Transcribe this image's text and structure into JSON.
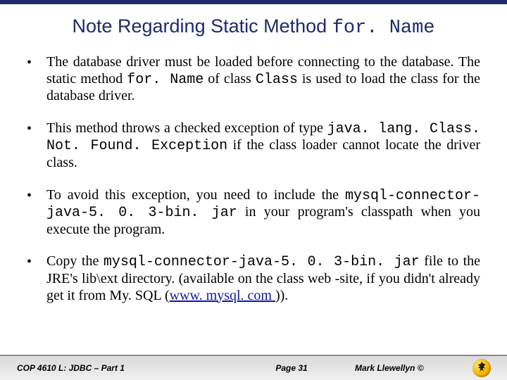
{
  "title_prefix": "Note Regarding Static Method ",
  "title_code": "for. Name",
  "bullets": [
    {
      "segments": [
        {
          "t": "The database driver must be loaded before connecting to the database.   The static method "
        },
        {
          "t": "for. Name",
          "cls": "mono"
        },
        {
          "t": " of class "
        },
        {
          "t": "Class",
          "cls": "mono"
        },
        {
          "t": " is used to load the class for the database driver."
        }
      ]
    },
    {
      "segments": [
        {
          "t": "This method throws a checked exception of type "
        },
        {
          "t": "java. lang. Class. Not. Found. Exception",
          "cls": "mono"
        },
        {
          "t": " if the class loader cannot locate the driver class."
        }
      ]
    },
    {
      "segments": [
        {
          "t": "To avoid this exception, you need to include the "
        },
        {
          "t": "mysql-connector-java-5. 0. 3-bin. jar",
          "cls": "mono"
        },
        {
          "t": " in your program's classpath when you execute the program."
        }
      ]
    },
    {
      "segments": [
        {
          "t": "Copy the "
        },
        {
          "t": "mysql-connector-java-5. 0. 3-bin. jar",
          "cls": "mono"
        },
        {
          "t": " file to the JRE's lib\\ext directory. (available on the class web -site, if you didn't already get it from My. SQL ("
        },
        {
          "t": "www. mysql. com ",
          "cls": "link"
        },
        {
          "t": "))."
        }
      ]
    }
  ],
  "footer": {
    "left": "COP 4610 L: JDBC – Part 1",
    "center": "Page 31",
    "right": "Mark Llewellyn ©"
  }
}
